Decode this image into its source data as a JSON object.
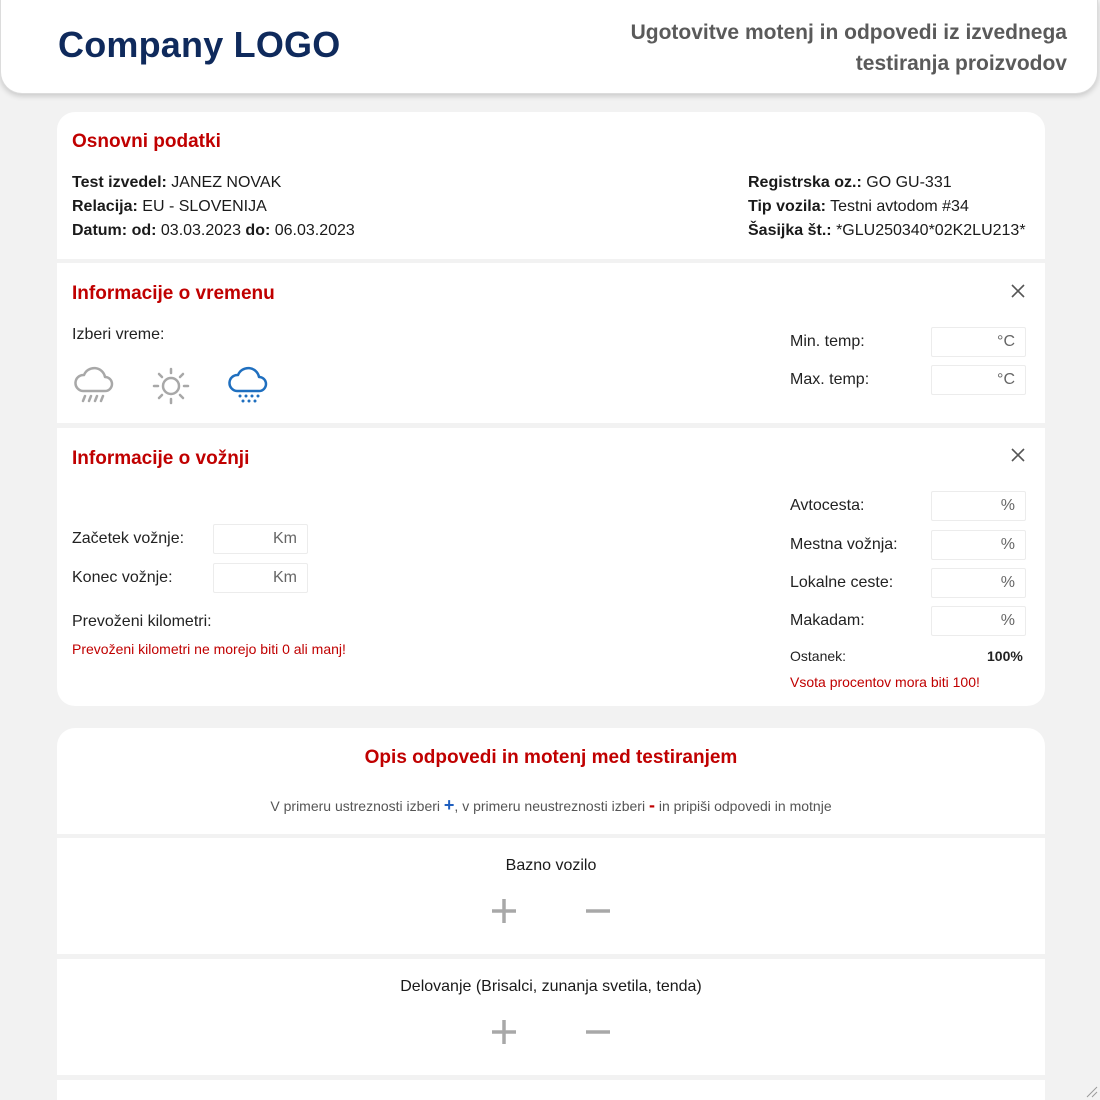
{
  "header": {
    "logo": "Company LOGO",
    "title": "Ugotovitve motenj in odpovedi iz izvednega testiranja proizvodov"
  },
  "basic": {
    "title": "Osnovni podatki",
    "tester_label": "Test izvedel:",
    "tester_value": "JANEZ NOVAK",
    "relation_label": "Relacija:",
    "relation_value": "EU - SLOVENIJA",
    "date_label": "Datum:",
    "from_label": "od:",
    "from_value": "03.03.2023",
    "to_label": "do:",
    "to_value": "06.03.2023",
    "reg_label": "Registrska oz.:",
    "reg_value": "GO GU-331",
    "type_label": "Tip vozila:",
    "type_value": "Testni avtodom #34",
    "chassis_label": "Šasijka št.:",
    "chassis_value": "*GLU250340*02K2LU213*"
  },
  "weather": {
    "title": "Informacije o vremenu",
    "choose_label": "Izberi vreme:",
    "icons": [
      "rain-cloud-icon",
      "sun-icon",
      "snow-cloud-icon"
    ],
    "selected": "snow-cloud-icon",
    "min_label": "Min. temp:",
    "max_label": "Max. temp:",
    "min_placeholder": "°C",
    "max_placeholder": "°C"
  },
  "drive": {
    "title": "Informacije o vožnji",
    "start_label": "Začetek vožnje:",
    "end_label": "Konec vožnje:",
    "km_placeholder": "Km",
    "driven_label": "Prevoženi kilometri:",
    "driven_error": "Prevoženi kilometri ne morejo biti 0 ali manj!",
    "highway_label": "Avtocesta:",
    "city_label": "Mestna vožnja:",
    "local_label": "Lokalne ceste:",
    "gravel_label": "Makadam:",
    "percent_placeholder": "%",
    "remainder_label": "Ostanek:",
    "remainder_value": "100%",
    "percent_error": "Vsota procentov mora biti 100!"
  },
  "description": {
    "title": "Opis odpovedi in motenj med testiranjem",
    "hint_before": "V primeru ustreznosti izberi",
    "hint_plus": "+",
    "hint_middle": ", v primeru neustreznosti izberi",
    "hint_minus": "-",
    "hint_after": "in pripiši odpovedi in motnje"
  },
  "items": [
    {
      "title": "Bazno vozilo"
    },
    {
      "title": "Delovanje (Brisalci, zunanja svetila, tenda)"
    }
  ],
  "colors": {
    "accent_red": "#c00000",
    "logo_blue": "#0f2a5c",
    "selected_icon_blue": "#1f6fbf",
    "icon_gray": "#a8a8a8"
  }
}
